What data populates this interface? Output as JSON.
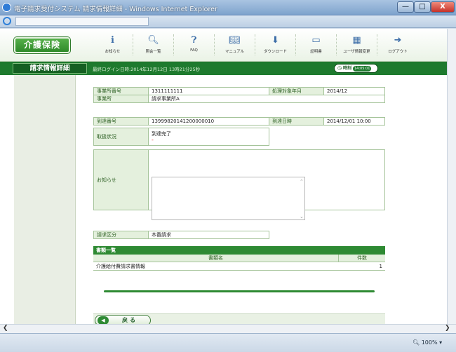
{
  "window": {
    "title": "電子請求受付システム  請求情報詳細 - Windows Internet Explorer",
    "min_glyph": "—",
    "max_glyph": "□",
    "close_glyph": "X"
  },
  "app": {
    "logo": "介護保険",
    "nav": [
      {
        "label": "お知らせ",
        "icon": "info-icon"
      },
      {
        "label": "照会一覧",
        "icon": "search-icon"
      },
      {
        "label": "FAQ",
        "icon": "faq-icon"
      },
      {
        "label": "マニュアル",
        "icon": "manual-icon"
      },
      {
        "label": "ダウンロード",
        "icon": "download-icon"
      },
      {
        "label": "証明書",
        "icon": "certificate-icon"
      },
      {
        "label": "ユーザ情報変更",
        "icon": "user-settings-icon"
      },
      {
        "label": "ログアウト",
        "icon": "logout-icon"
      }
    ]
  },
  "screen": {
    "title": "請求情報詳細",
    "last_login": "最終ログイン日時:2014年12月12日 13時21分25秒",
    "clock_label": "時刻",
    "clock_seconds": "14:05:01"
  },
  "detail": {
    "office_no_label": "事業所番号",
    "office_no": "1311111111",
    "period_label": "処理対象年月",
    "period": "2014/12",
    "office_label": "事業所",
    "office": "請求事業所A",
    "arrival_no_label": "到達番号",
    "arrival_no": "13999820141200000010",
    "arrival_date_label": "到達日時",
    "arrival_date": "2014/12/01 10:00",
    "status_label": "取扱状況",
    "status": "到達完了",
    "status_note": "-",
    "notice_label": "お知らせ",
    "notice": "",
    "category_label": "請求区分",
    "category": "本番請求"
  },
  "documents": {
    "heading": "書類一覧",
    "col_name": "書類名",
    "col_count": "件数",
    "rows": [
      {
        "name": "介護給付費請求書情報",
        "count": "1"
      }
    ]
  },
  "buttons": {
    "back": "戻る",
    "back_arrow": "◀"
  },
  "statusbar": {
    "zoom": "100%"
  },
  "colors": {
    "brand_green": "#1e7a2e",
    "label_bg": "#e4f0dd"
  }
}
